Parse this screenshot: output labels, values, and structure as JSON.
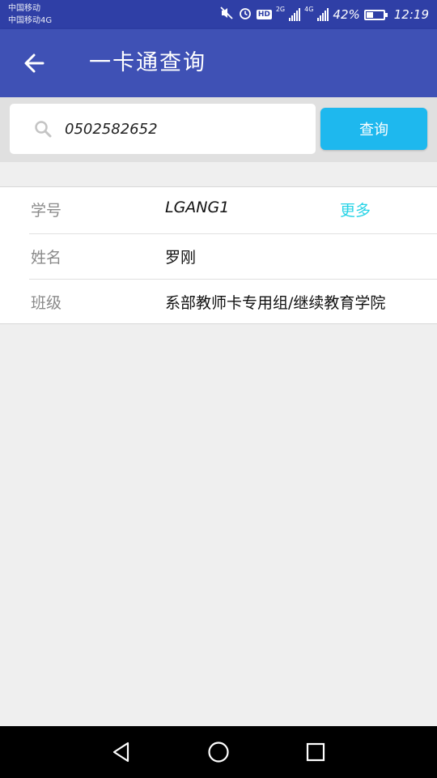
{
  "status_bar": {
    "carrier1": "中国移动",
    "carrier2": "中国移动4G",
    "icons": [
      "mute-icon",
      "alarm-icon",
      "hd-icon",
      "signal-2g-icon",
      "signal-4g-icon"
    ],
    "network1": "2G",
    "network2": "4G",
    "hd": "HD",
    "battery_percent": "42%",
    "battery_level": 0.42,
    "time": "12:19"
  },
  "app_bar": {
    "title": "一卡通查询",
    "back_icon": "back-arrow-icon"
  },
  "search": {
    "value": "0502582652",
    "icon": "search-icon",
    "button_label": "查询"
  },
  "info": {
    "rows": [
      {
        "label": "学号",
        "value": "LGANG1",
        "action": "更多"
      },
      {
        "label": "姓名",
        "value": "罗刚"
      },
      {
        "label": "班级",
        "value": "系部教师卡专用组/继续教育学院"
      }
    ]
  },
  "nav_bar": {
    "icons": [
      "back-triangle-icon",
      "home-circle-icon",
      "recents-square-icon"
    ]
  },
  "colors": {
    "status_bar": "#2f3fa6",
    "app_bar": "#3f51b5",
    "button": "#1eb8ee",
    "link": "#27d3e6",
    "caret": "#e91e63"
  }
}
